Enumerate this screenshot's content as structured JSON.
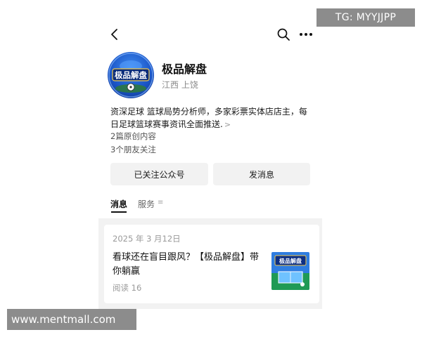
{
  "overlay": {
    "telegram_tag": "TG: MYYJJPP",
    "site_watermark": "www.mentmall.com"
  },
  "profile": {
    "avatar_text": "极品解盘",
    "name": "极品解盘",
    "location": "江西 上饶",
    "description": "资深足球 篮球局势分析师，多家彩票实体店店主，每日足球篮球赛事资讯全面推送.",
    "description_more": ">",
    "original_count": "2篇原创内容",
    "friends_following": "3个朋友关注"
  },
  "actions": {
    "follow_label": "已关注公众号",
    "message_label": "发消息"
  },
  "tabs": {
    "messages": "消息",
    "services": "服务",
    "services_icon": "≡"
  },
  "article": {
    "date": "2025 年 3 月12日",
    "title": "看球还在盲目跟风？【极品解盘】带你躺赢",
    "reads": "阅读 16",
    "thumbnail_text": "极品解盘"
  },
  "icons": {
    "back": "chevron-left-icon",
    "search": "search-icon",
    "more": "more-dots-icon"
  },
  "colors": {
    "avatar_blue": "#1b56c8",
    "avatar_gold": "#f2c94c",
    "button_bg": "#f2f2f2",
    "feed_bg": "#f2f2f2",
    "muted_text": "#9a9a9a"
  }
}
